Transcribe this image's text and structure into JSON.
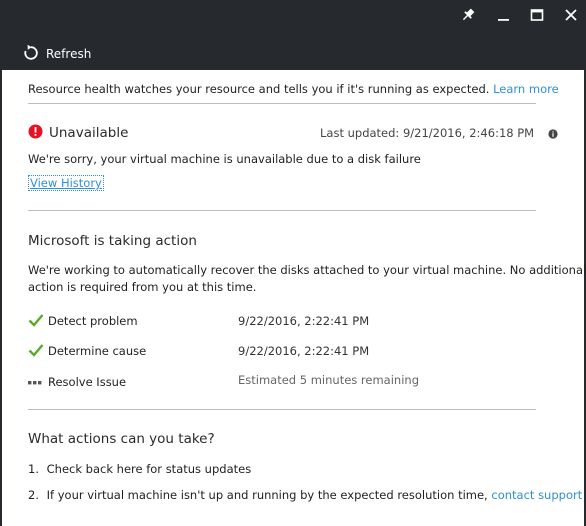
{
  "toolbar": {
    "refresh_label": "Refresh"
  },
  "intro": {
    "text": "Resource health watches your resource and tells you if it's running as expected.",
    "learn_more": "Learn more"
  },
  "status": {
    "title": "Unavailable",
    "last_updated_label": "Last updated:",
    "last_updated_value": "9/21/2016, 2:46:18 PM",
    "message": "We're sorry, your virtual machine is unavailable due to a disk failure",
    "view_history": "View History",
    "error_color": "#e81123"
  },
  "action": {
    "heading": "Microsoft is taking action",
    "description_line1": "We're working to automatically recover the disks attached to your virtual machine. No additional",
    "description_line2": "action is required from you at this time.",
    "steps": [
      {
        "label": "Detect problem",
        "time": "9/22/2016, 2:22:41 PM",
        "state": "done"
      },
      {
        "label": "Determine cause",
        "time": "9/22/2016, 2:22:41 PM",
        "state": "done"
      },
      {
        "label": "Resolve Issue",
        "time": "Estimated 5 minutes remaining",
        "state": "in-progress"
      }
    ],
    "check_color": "#5ba82a"
  },
  "user_actions": {
    "heading": "What actions can you take?",
    "items": [
      {
        "number": "1.",
        "text": "Check back here for status updates",
        "link": ""
      },
      {
        "number": "2.",
        "text": "If your virtual machine isn't up and running by the expected resolution time,",
        "link": "contact support"
      }
    ]
  }
}
